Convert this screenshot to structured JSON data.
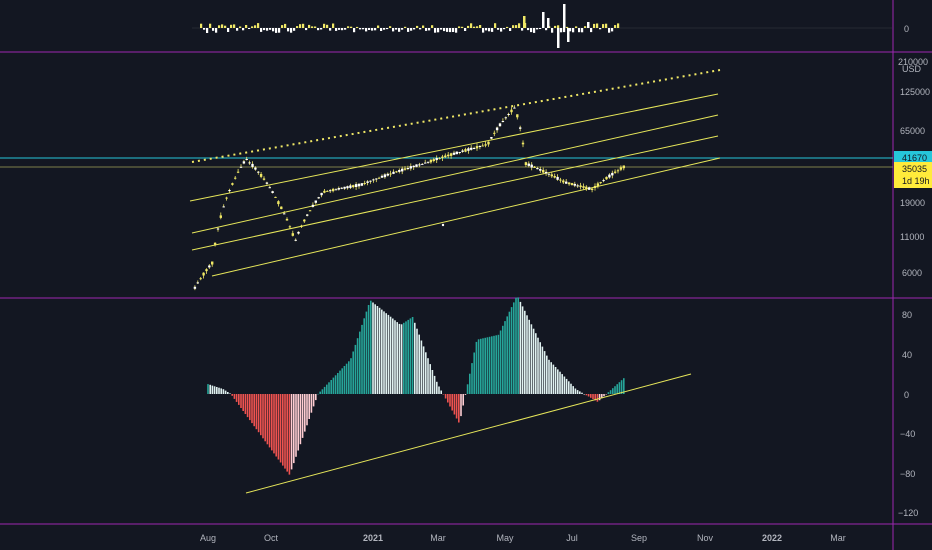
{
  "colors": {
    "background": "#131722",
    "pane_divider": "#9c27b0",
    "axis_text": "#b2b5be",
    "channel_line": "#e6e65a",
    "price_candle": "#f0e866",
    "price_label_bg": "#ffeb3b",
    "horizontal_level": "#26c6da",
    "horizontal_level_2": "#a3a35a",
    "hist_pos_strong": "#26a69a",
    "hist_pos_weak": "#e0f2f1",
    "hist_neg_strong": "#ef5350",
    "hist_neg_weak": "#ffcdd2",
    "volume_up": "#f0e866",
    "volume_down": "#ffffff"
  },
  "top_pane": {
    "axis_label": "0"
  },
  "price_pane": {
    "currency": "USD",
    "axis_labels": [
      "125000",
      "65000",
      "19000",
      "11000",
      "6000"
    ],
    "horizontal_level_label": "41670",
    "price_label": "35035",
    "countdown_label": "1d 19h"
  },
  "oscillator_pane": {
    "axis_labels": [
      "80",
      "40",
      "0",
      "−40",
      "−80",
      "−120"
    ]
  },
  "time_axis": {
    "labels": [
      "Aug",
      "Oct",
      "2021",
      "Mar",
      "May",
      "Jul",
      "Sep",
      "Nov",
      "2022",
      "Mar"
    ],
    "bold_labels": [
      "2021",
      "2022"
    ]
  },
  "chart_data": [
    {
      "type": "bar",
      "name": "volume-delta",
      "points": 140,
      "spikes": [
        {
          "month_index": 9.3,
          "direction": "up"
        },
        {
          "month_index": 9.6,
          "direction": "down"
        },
        {
          "month_index": 10.0,
          "direction": "up"
        },
        {
          "month_index": 10.2,
          "direction": "down"
        }
      ]
    },
    {
      "type": "line",
      "name": "price",
      "y_scale": "log",
      "y_ticks": [
        6000,
        11000,
        19000,
        65000,
        125000
      ],
      "x_start": "2020-07-20",
      "x_end": "2021-08-18",
      "key_points": [
        {
          "x": "2020-07-20",
          "y": 4600
        },
        {
          "x": "2020-08-05",
          "y": 7000
        },
        {
          "x": "2020-08-25",
          "y": 28000
        },
        {
          "x": "2020-09-05",
          "y": 40000
        },
        {
          "x": "2020-10-05",
          "y": 19000
        },
        {
          "x": "2020-10-20",
          "y": 10000
        },
        {
          "x": "2020-11-15",
          "y": 23000
        },
        {
          "x": "2020-12-20",
          "y": 26000
        },
        {
          "x": "2021-02-15",
          "y": 37000
        },
        {
          "x": "2021-04-15",
          "y": 51000
        },
        {
          "x": "2021-05-10",
          "y": 95000
        },
        {
          "x": "2021-05-20",
          "y": 37000
        },
        {
          "x": "2021-06-25",
          "y": 27000
        },
        {
          "x": "2021-07-20",
          "y": 24000
        },
        {
          "x": "2021-08-18",
          "y": 35035
        }
      ],
      "horizontal_levels": [
        41670,
        35035
      ]
    },
    {
      "type": "bar",
      "name": "oscillator",
      "ylim": [
        -120,
        100
      ],
      "y_ticks": [
        80,
        40,
        0,
        -40,
        -80,
        -120
      ],
      "key_points": [
        {
          "x": "2020-08-01",
          "y": 10
        },
        {
          "x": "2020-08-15",
          "y": 5
        },
        {
          "x": "2020-08-22",
          "y": 0
        },
        {
          "x": "2020-10-15",
          "y": -82
        },
        {
          "x": "2020-11-10",
          "y": 0
        },
        {
          "x": "2020-12-10",
          "y": 35
        },
        {
          "x": "2020-12-28",
          "y": 95
        },
        {
          "x": "2021-01-25",
          "y": 70
        },
        {
          "x": "2021-02-05",
          "y": 78
        },
        {
          "x": "2021-02-28",
          "y": 10
        },
        {
          "x": "2021-03-20",
          "y": -30
        },
        {
          "x": "2021-04-05",
          "y": 55
        },
        {
          "x": "2021-04-25",
          "y": 60
        },
        {
          "x": "2021-05-12",
          "y": 100
        },
        {
          "x": "2021-06-10",
          "y": 35
        },
        {
          "x": "2021-07-05",
          "y": 5
        },
        {
          "x": "2021-07-25",
          "y": -8
        },
        {
          "x": "2021-08-18",
          "y": 16
        }
      ]
    }
  ]
}
